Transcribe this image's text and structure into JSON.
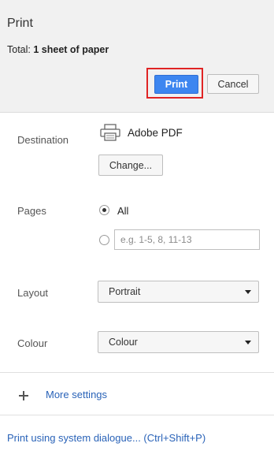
{
  "header": {
    "title": "Print",
    "total_label": "Total:",
    "total_value": "1 sheet of paper",
    "print_label": "Print",
    "cancel_label": "Cancel"
  },
  "destination": {
    "label": "Destination",
    "icon": "printer-icon",
    "name": "Adobe PDF",
    "change_label": "Change..."
  },
  "pages": {
    "label": "Pages",
    "all_label": "All",
    "all_selected": true,
    "custom_placeholder": "e.g. 1-5, 8, 11-13"
  },
  "layout": {
    "label": "Layout",
    "value": "Portrait"
  },
  "colour": {
    "label": "Colour",
    "value": "Colour"
  },
  "more_settings": {
    "label": "More settings",
    "icon": "plus-icon"
  },
  "system_dialogue": {
    "label": "Print using system dialogue... (Ctrl+Shift+P)"
  },
  "colors": {
    "primary_button": "#3d86f0",
    "highlight_border": "#e02424",
    "link": "#2a63b8",
    "header_bg": "#f1f1f1"
  }
}
